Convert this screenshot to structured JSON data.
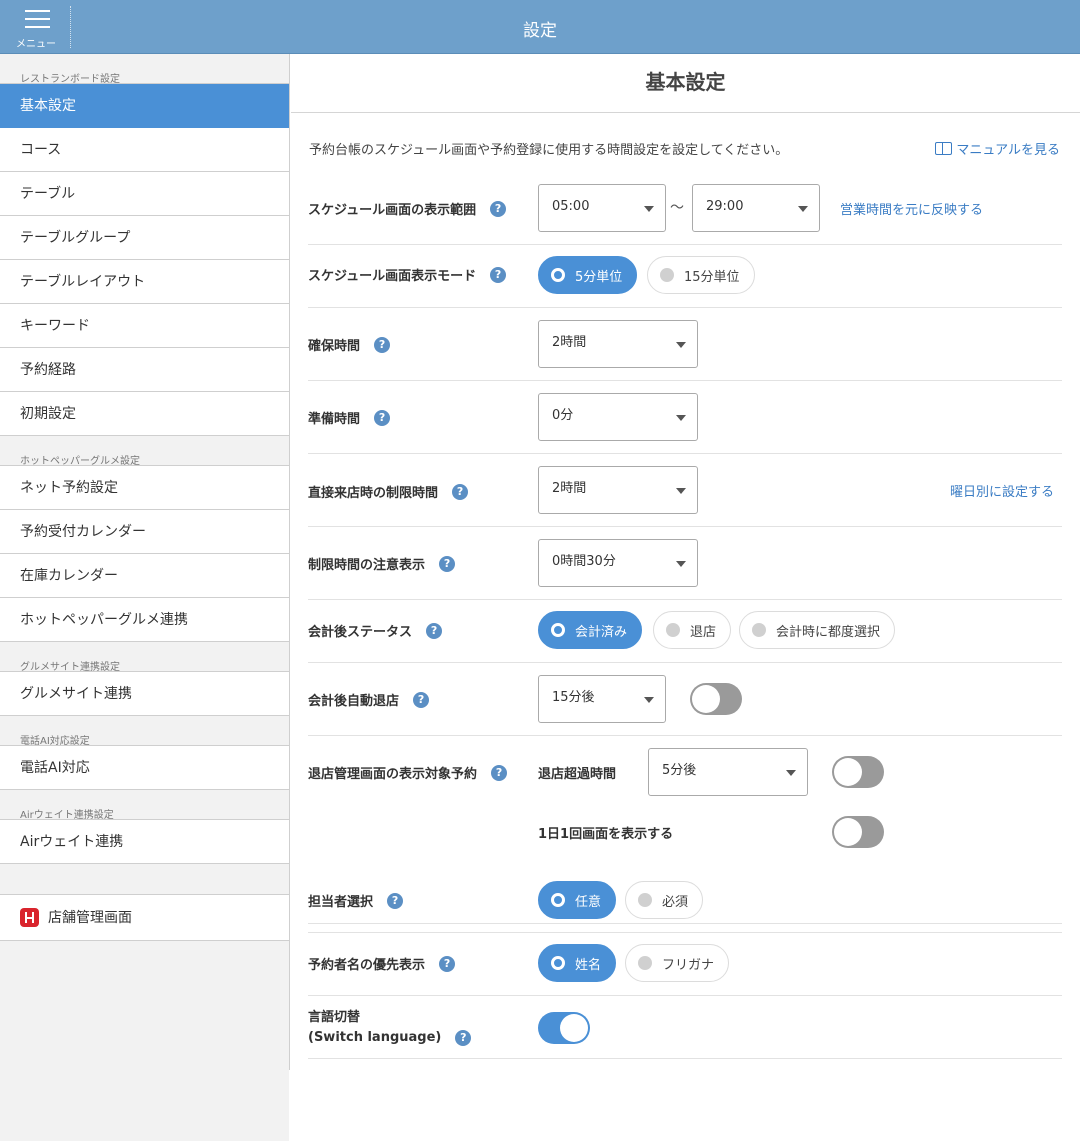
{
  "header": {
    "menu_label": "メニュー",
    "title": "設定"
  },
  "sidebar": {
    "sections": [
      {
        "title": "レストランボード設定",
        "items": [
          "基本設定",
          "コース",
          "テーブル",
          "テーブルグループ",
          "テーブルレイアウト",
          "キーワード",
          "予約経路",
          "初期設定"
        ]
      },
      {
        "title": "ホットペッパーグルメ設定",
        "items": [
          "ネット予約設定",
          "予約受付カレンダー",
          "在庫カレンダー",
          "ホットペッパーグルメ連携"
        ]
      },
      {
        "title": "グルメサイト連携設定",
        "items": [
          "グルメサイト連携"
        ]
      },
      {
        "title": "電話AI対応設定",
        "items": [
          "電話AI対応"
        ]
      },
      {
        "title": "Airウェイト連携設定",
        "items": [
          "Airウェイト連携"
        ]
      }
    ],
    "store_link": "店舗管理画面"
  },
  "main": {
    "title": "基本設定",
    "description": "予約台帳のスケジュール画面や予約登録に使用する時間設定を設定してください。",
    "manual_link": "マニュアルを見る",
    "help_mark": "?",
    "rows": {
      "schedule_range": {
        "label": "スケジュール画面の表示範囲",
        "from": "05:00",
        "sep": "〜",
        "to": "29:00",
        "link": "営業時間を元に反映する"
      },
      "display_mode": {
        "label": "スケジュール画面表示モード",
        "options": [
          "5分単位",
          "15分単位"
        ],
        "selected": "5分単位"
      },
      "hold_time": {
        "label": "確保時間",
        "value": "2時間"
      },
      "prep_time": {
        "label": "準備時間",
        "value": "0分"
      },
      "walkin_limit": {
        "label": "直接来店時の制限時間",
        "value": "2時間",
        "link": "曜日別に設定する"
      },
      "limit_notice": {
        "label": "制限時間の注意表示",
        "value": "0時間30分"
      },
      "after_payment_status": {
        "label": "会計後ステータス",
        "options": [
          "会計済み",
          "退店",
          "会計時に都度選択"
        ],
        "selected": "会計済み"
      },
      "auto_exit": {
        "label": "会計後自動退店",
        "value": "15分後",
        "toggle": false
      },
      "exit_display": {
        "label": "退店管理画面の表示対象予約",
        "sub1_label": "退店超過時間",
        "sub1_value": "5分後",
        "sub1_toggle": false,
        "sub2_label": "1日1回画面を表示する",
        "sub2_toggle": false
      },
      "staff_select": {
        "label": "担当者選択",
        "options": [
          "任意",
          "必須"
        ],
        "selected": "任意"
      },
      "name_priority": {
        "label": "予約者名の優先表示",
        "options": [
          "姓名",
          "フリガナ"
        ],
        "selected": "姓名"
      },
      "language": {
        "label_line1": "言語切替",
        "label_line2": "(Switch language)",
        "toggle": true
      }
    }
  },
  "colors": {
    "header": "#6ea0cb",
    "accent": "#4a90d6",
    "link": "#3a7cc4"
  }
}
